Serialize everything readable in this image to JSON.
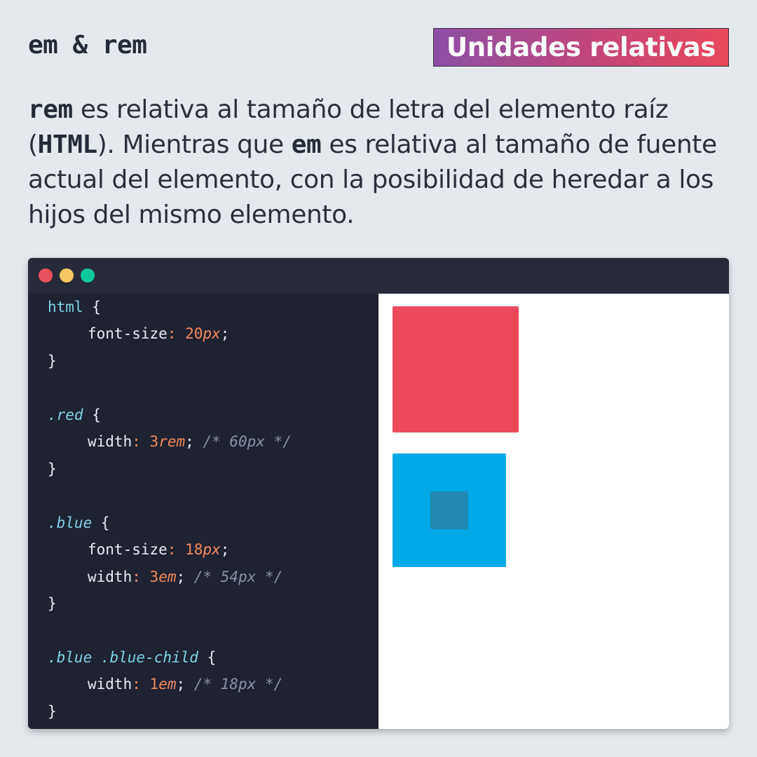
{
  "header": {
    "title": "em & rem",
    "badge": "Unidades relativas"
  },
  "intro": {
    "kw_rem": "rem",
    "t1": " es relativa al tamaño de letra del elemento raíz (",
    "kw_html": "HTML",
    "t2": "). Mientras que ",
    "kw_em": "em",
    "t3": " es relativa al tamaño de fuente actual del elemento, con la posibilidad de heredar a los hijos del mismo elemento."
  },
  "code": {
    "l1_sel": "html",
    "open": " {",
    "close": "}",
    "semi": ";",
    "colon": ":",
    "l2_prop": "font-size",
    "l2_num": "20",
    "l2_unit": "px",
    "l5_sel": ".red",
    "l6_prop": "width",
    "l6_num": "3",
    "l6_unit": "rem",
    "l6_cmt": "/* 60px */",
    "l9_sel": ".blue",
    "l10_prop": "font-size",
    "l10_num": "18",
    "l10_unit": "px",
    "l11_prop": "width",
    "l11_num": "3",
    "l11_unit": "em",
    "l11_cmt": "/* 54px */",
    "l14_sel": ".blue .blue-child",
    "l15_prop": "width",
    "l15_num": "1",
    "l15_unit": "em",
    "l15_cmt": "/* 18px */"
  },
  "colors": {
    "red": "#ec4a5a",
    "blue": "#00a9e8",
    "blue_child": "#208ab4",
    "dot_red": "#e9505d",
    "dot_yellow": "#f6c85f",
    "dot_green": "#10c99a"
  }
}
